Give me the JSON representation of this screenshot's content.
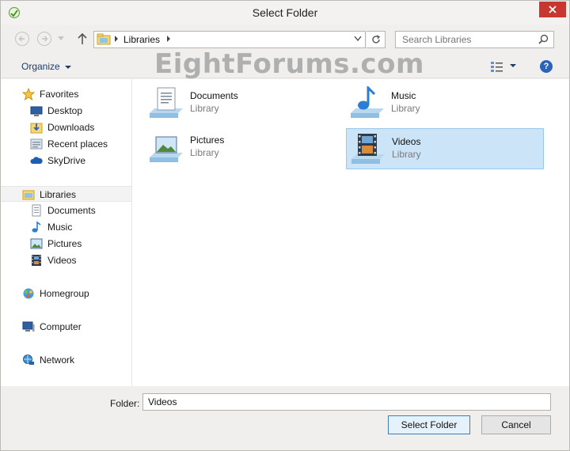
{
  "window": {
    "title": "Select Folder"
  },
  "address": {
    "path": "Libraries"
  },
  "search": {
    "placeholder": "Search Libraries"
  },
  "toolbar": {
    "organize_label": "Organize"
  },
  "watermark": "EightForums.com",
  "sidebar": {
    "favorites": {
      "label": "Favorites",
      "items": [
        {
          "label": "Desktop",
          "icon": "desktop-icon"
        },
        {
          "label": "Downloads",
          "icon": "downloads-icon"
        },
        {
          "label": "Recent places",
          "icon": "recent-places-icon"
        },
        {
          "label": "SkyDrive",
          "icon": "skydrive-icon"
        }
      ]
    },
    "libraries": {
      "label": "Libraries",
      "items": [
        {
          "label": "Documents",
          "icon": "documents-icon"
        },
        {
          "label": "Music",
          "icon": "music-icon"
        },
        {
          "label": "Pictures",
          "icon": "pictures-icon"
        },
        {
          "label": "Videos",
          "icon": "videos-icon"
        }
      ]
    },
    "homegroup": {
      "label": "Homegroup"
    },
    "computer": {
      "label": "Computer"
    },
    "network": {
      "label": "Network"
    }
  },
  "libraries": [
    {
      "name": "Documents",
      "type": "Library",
      "icon": "documents-library-icon"
    },
    {
      "name": "Music",
      "type": "Library",
      "icon": "music-library-icon"
    },
    {
      "name": "Pictures",
      "type": "Library",
      "icon": "pictures-library-icon"
    },
    {
      "name": "Videos",
      "type": "Library",
      "icon": "videos-library-icon",
      "selected": true
    }
  ],
  "footer": {
    "folder_label": "Folder:",
    "folder_value": "Videos",
    "select_button": "Select Folder",
    "cancel_button": "Cancel"
  },
  "colors": {
    "close": "#c7372f",
    "selection": "#cce4f7",
    "selection_border": "#99c9ef",
    "link": "#1d3c6e"
  }
}
